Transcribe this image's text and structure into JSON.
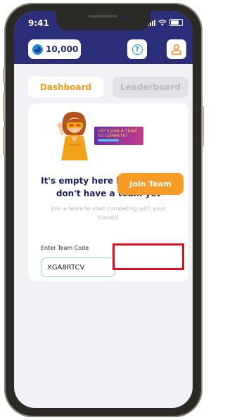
{
  "status_bar": {
    "time": "9:41"
  },
  "header": {
    "coins": "10,000",
    "help_symbol": "?"
  },
  "tabs": [
    {
      "label": "Dashboard",
      "active": true
    },
    {
      "label": "Leaderboard",
      "active": false
    }
  ],
  "empty_state": {
    "banner_text": "LET'S JOIN A TEAM TO COMPETE!",
    "title": "It's empty here because you don't have a team yet",
    "subtitle": "Join a team to start competing with your friends!"
  },
  "team_form": {
    "label": "Enter Team Code",
    "code_value": "XGA8RTCV",
    "join_label": "Join Team"
  },
  "colors": {
    "header_bg": "#2b2f7a",
    "accent_orange": "#f79b26",
    "title_navy": "#1d2067",
    "highlight_red": "#e0101a"
  },
  "icons": [
    "coin-icon",
    "help-icon",
    "profile-icon",
    "wifi-icon",
    "battery-icon"
  ]
}
